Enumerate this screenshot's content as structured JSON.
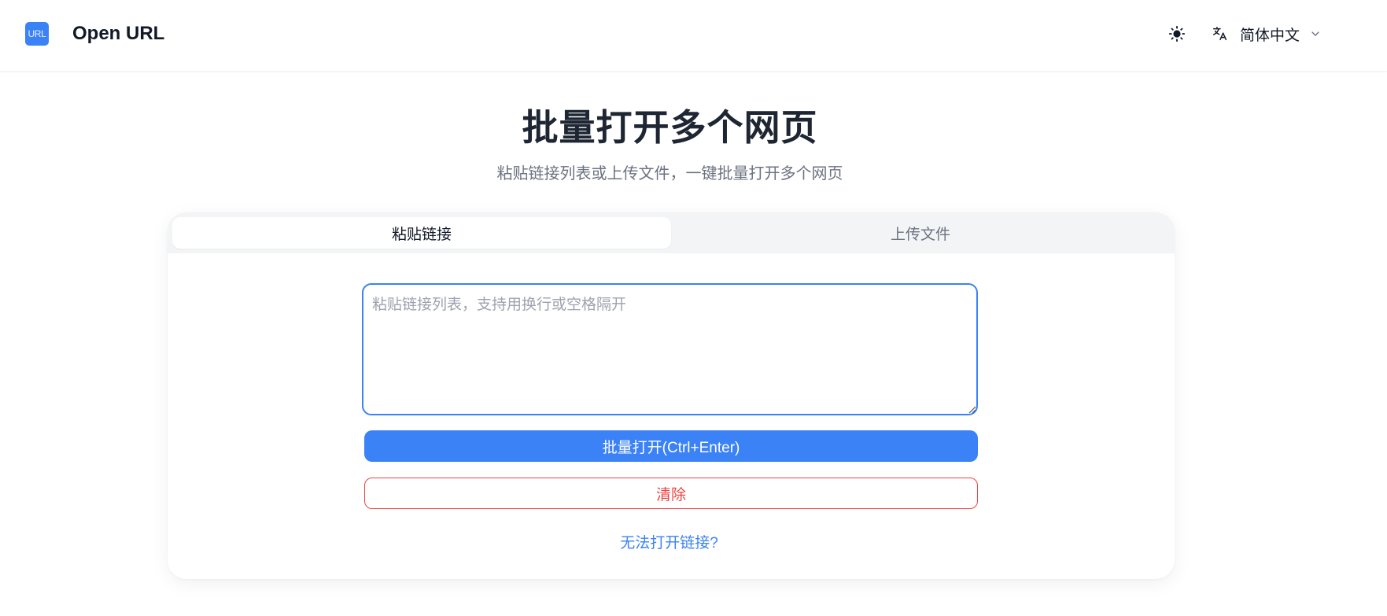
{
  "header": {
    "logo_text": "URL",
    "brand": "Open URL",
    "theme_icon": "sun-icon",
    "language": {
      "icon": "translate-icon",
      "label": "简体中文",
      "chevron": "chevron-down-icon"
    }
  },
  "hero": {
    "title": "批量打开多个网页",
    "subtitle": "粘贴链接列表或上传文件，一键批量打开多个网页"
  },
  "tabs": [
    {
      "label": "粘贴链接",
      "active": true
    },
    {
      "label": "上传文件",
      "active": false
    }
  ],
  "form": {
    "textarea_value": "",
    "textarea_placeholder": "粘贴链接列表，支持用换行或空格隔开",
    "open_button_label": "批量打开(Ctrl+Enter)",
    "clear_button_label": "清除",
    "help_link": "无法打开链接?"
  },
  "colors": {
    "accent": "#3b82f6",
    "danger": "#ef4444",
    "tab_bg": "#f3f4f6"
  }
}
